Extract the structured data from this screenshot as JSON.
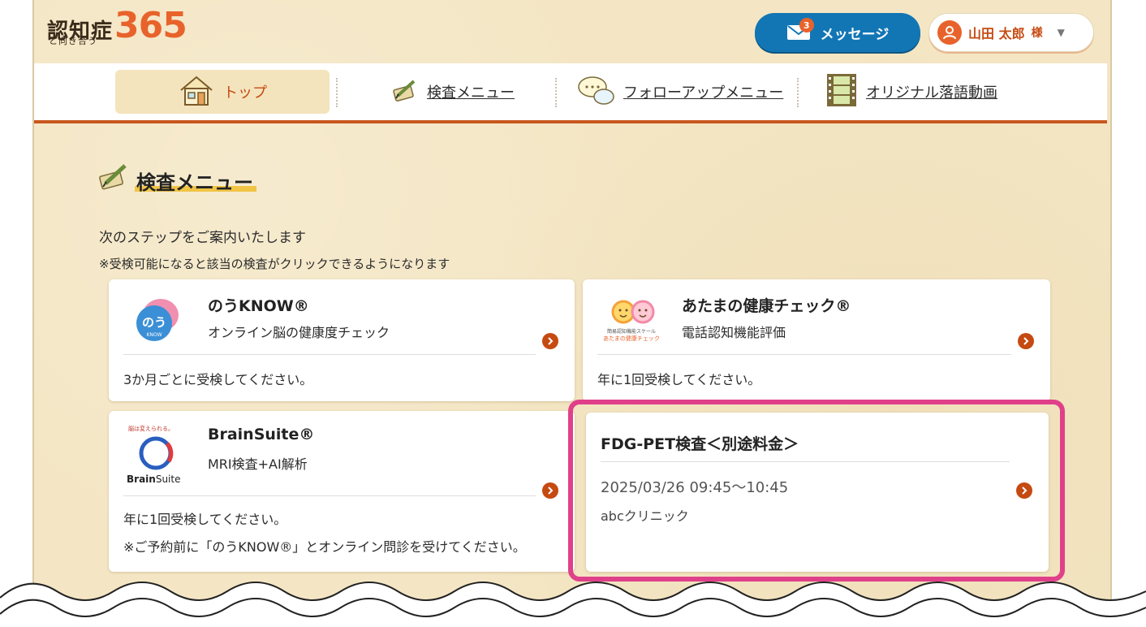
{
  "logo": {
    "word": "認知症",
    "number": "365",
    "subtitle": "と向き合う"
  },
  "header": {
    "message_button": {
      "label": "メッセージ",
      "badge": "3"
    },
    "user_button": {
      "name": "山田 太郎",
      "honorific": "様"
    }
  },
  "nav": {
    "items": [
      {
        "label": "トップ",
        "icon": "house-icon"
      },
      {
        "label": "検査メニュー",
        "icon": "pencil-book-icon"
      },
      {
        "label": "フォローアップメニュー",
        "icon": "speech-bubble-icon"
      },
      {
        "label": "オリジナル落語動画",
        "icon": "film-icon"
      }
    ]
  },
  "section": {
    "title": "検査メニュー",
    "intro": "次のステップをご案内いたします",
    "note": "※受検可能になると該当の検査がクリックできるようになります"
  },
  "cards": [
    {
      "name": "のうKNOW®",
      "subtitle": "オンライン脳の健康度チェック",
      "note": "3か月ごとに受検してください。",
      "logo_text": "のう",
      "logo_sub": "KNOW"
    },
    {
      "name": "あたまの健康チェック®",
      "subtitle": "電話認知機能評価",
      "note": "年に1回受検してください。",
      "logo_small": "簡易認知機能スケール",
      "logo_text": "あたまの健康チェック"
    },
    {
      "name": "BrainSuite®",
      "subtitle": "MRI検査+AI解析",
      "note": "年に1回受検してください。",
      "note2": "※ご予約前に「のうKNOW®」とオンライン問診を受けてください。",
      "logo_top": "脳は変えられる。",
      "logo_brand_bold": "Brain",
      "logo_brand": "Suite"
    },
    {
      "name": "FDG-PET検査＜別途料金＞",
      "datetime": "2025/03/26 09:45〜10:45",
      "clinic": "abcクリニック"
    }
  ],
  "colors": {
    "accent": "#c54a12",
    "message_blue": "#1276b5",
    "highlight": "#e0408a",
    "background": "#f4e6c4"
  }
}
